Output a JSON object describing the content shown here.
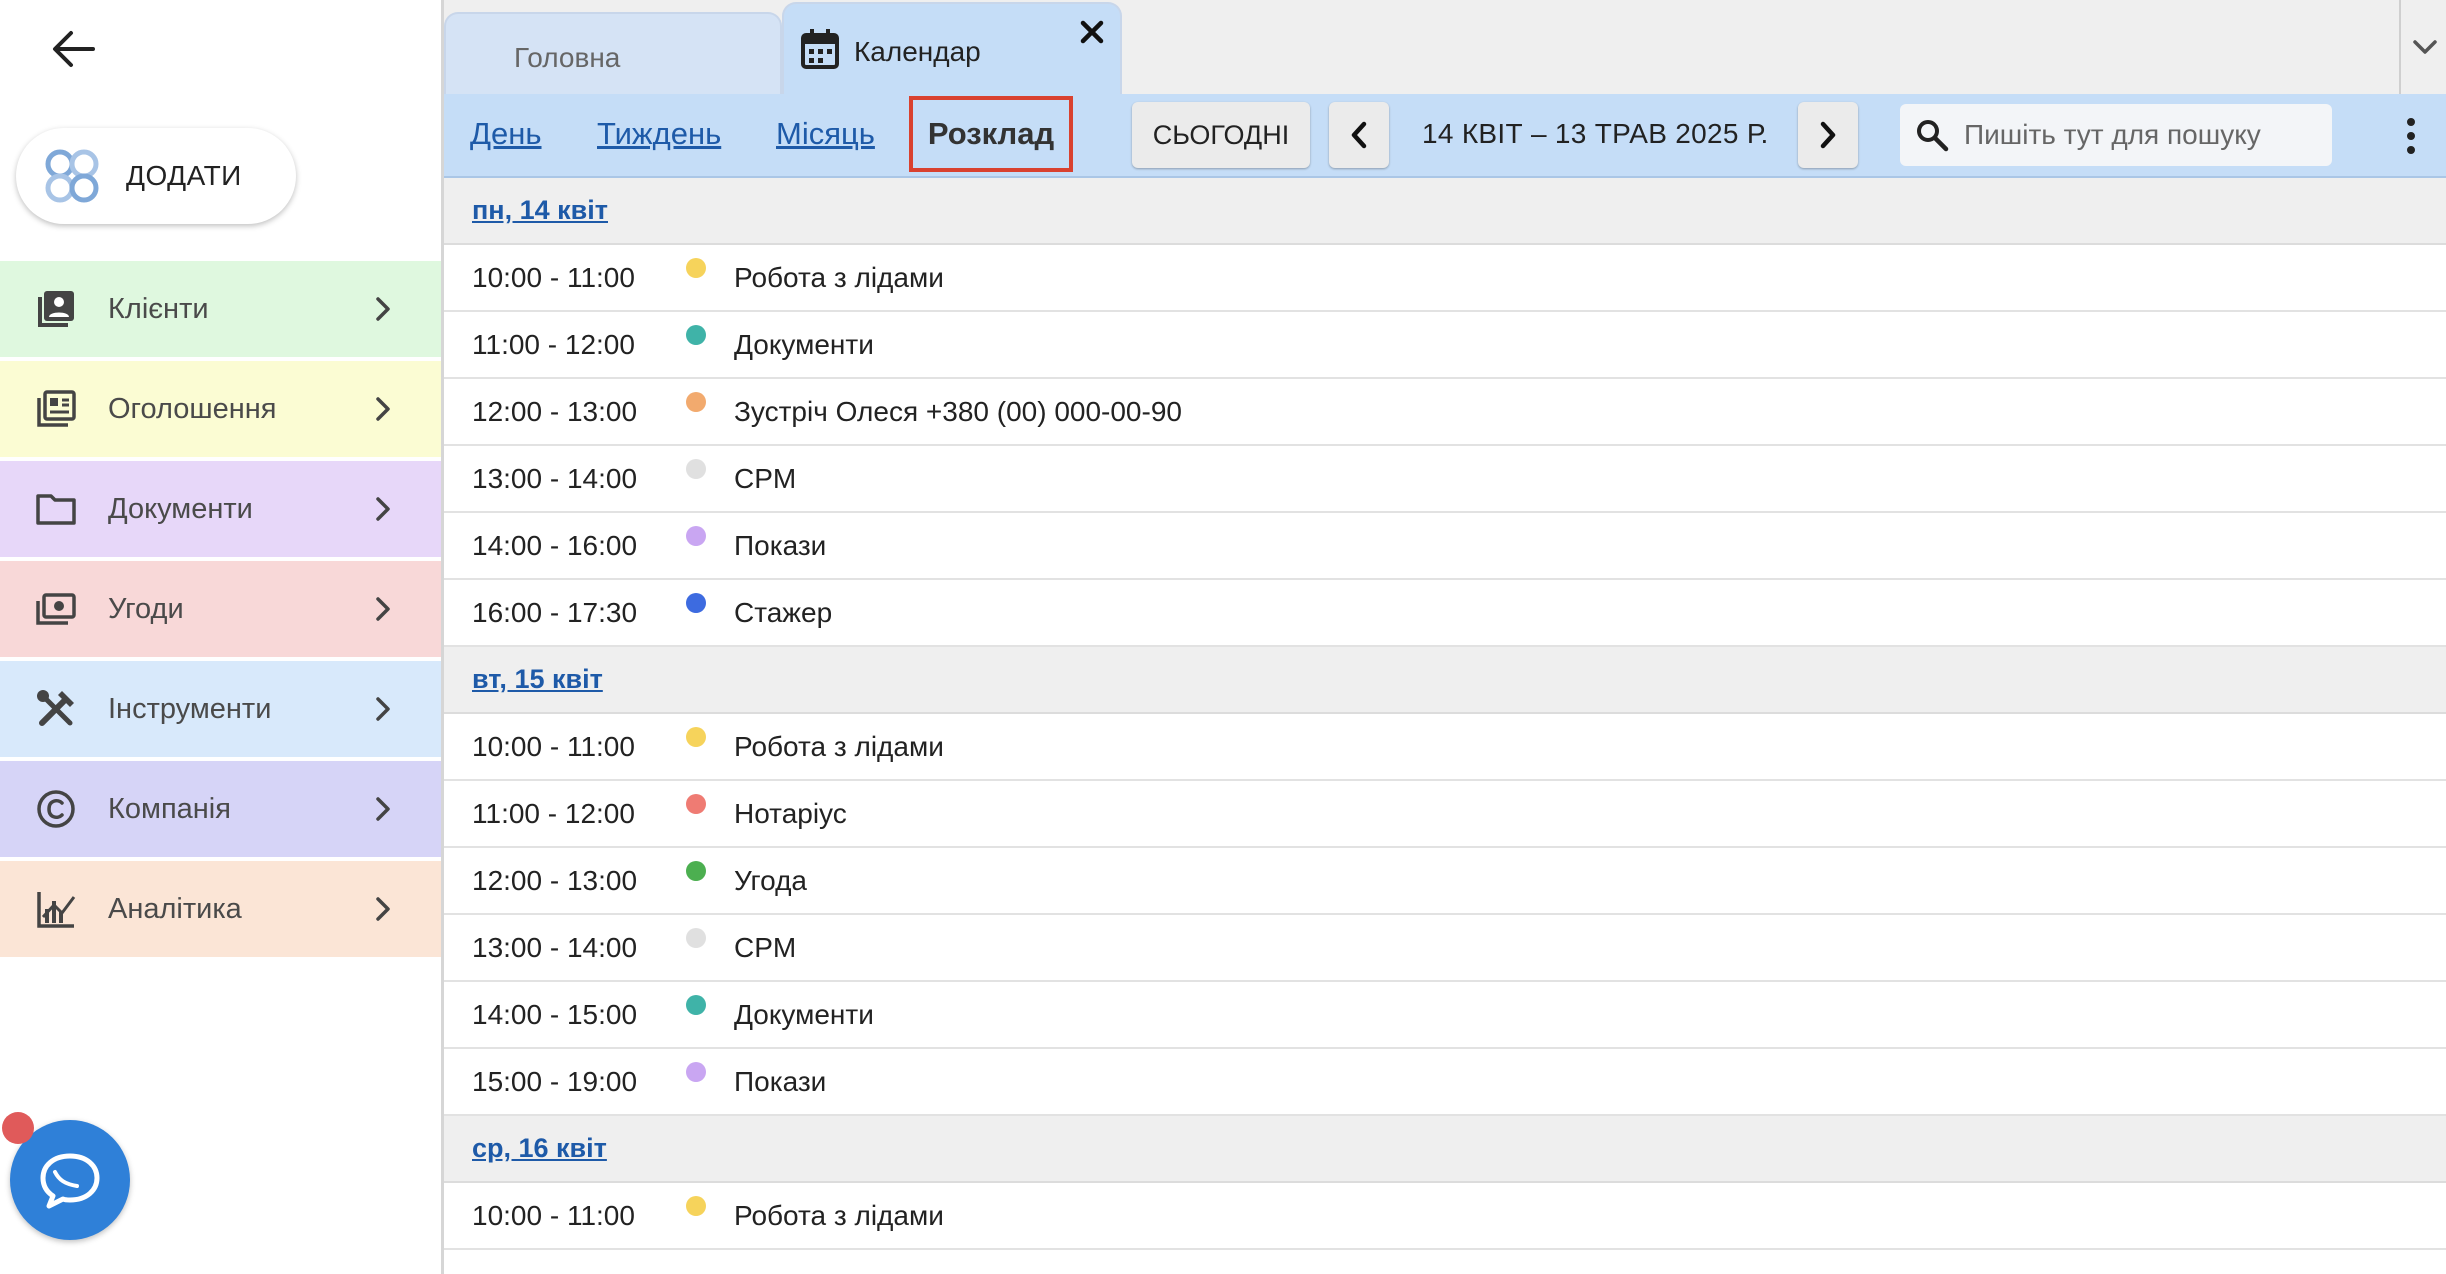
{
  "sidebar": {
    "add_label": "ДОДАТИ",
    "items": [
      {
        "label": "Клієнти",
        "icon": "contacts-icon",
        "color": "#dff8df"
      },
      {
        "label": "Оголошення",
        "icon": "listing-icon",
        "color": "#fbfcd3"
      },
      {
        "label": "Документи",
        "icon": "folder-icon",
        "color": "#e7d7f9"
      },
      {
        "label": "Угоди",
        "icon": "money-icon",
        "color": "#f8d8d8"
      },
      {
        "label": "Інструменти",
        "icon": "tools-icon",
        "color": "#d8e9fb"
      },
      {
        "label": "Компанія",
        "icon": "copyright-icon",
        "color": "#d6d4f7"
      },
      {
        "label": "Аналітика",
        "icon": "analytics-icon",
        "color": "#fbe5d6"
      }
    ]
  },
  "tabs": [
    {
      "label": "Головна"
    },
    {
      "label": "Календар"
    }
  ],
  "toolbar": {
    "views": [
      "День",
      "Тиждень",
      "Місяць",
      "Розклад"
    ],
    "today_label": "СЬОГОДНІ",
    "date_range": "14 КВІТ – 13 ТРАВ 2025 Р.",
    "search_placeholder": "Пишіть тут для пошуку"
  },
  "days": [
    {
      "header": "пн, 14 квіт",
      "events": [
        {
          "time": "10:00 - 11:00",
          "title": "Робота з лідами",
          "color": "#f6d35b"
        },
        {
          "time": "11:00 - 12:00",
          "title": "Документи",
          "color": "#3fb3a8"
        },
        {
          "time": "12:00 - 13:00",
          "title": "Зустріч Олеся +380 (00) 000-00-90",
          "color": "#f2aa6e"
        },
        {
          "time": "13:00 - 14:00",
          "title": "CPM",
          "color": "#e0e0e0"
        },
        {
          "time": "14:00 - 16:00",
          "title": "Покази",
          "color": "#c9a6f2"
        },
        {
          "time": "16:00 - 17:30",
          "title": "Стажер",
          "color": "#3d6be0"
        }
      ]
    },
    {
      "header": "вт, 15 квіт",
      "events": [
        {
          "time": "10:00 - 11:00",
          "title": "Робота з лідами",
          "color": "#f6d35b"
        },
        {
          "time": "11:00 - 12:00",
          "title": "Нотаріус",
          "color": "#ef7b73"
        },
        {
          "time": "12:00 - 13:00",
          "title": "Угода",
          "color": "#4caf50"
        },
        {
          "time": "13:00 - 14:00",
          "title": "CPM",
          "color": "#e0e0e0"
        },
        {
          "time": "14:00 - 15:00",
          "title": "Документи",
          "color": "#3fb3a8"
        },
        {
          "time": "15:00 - 19:00",
          "title": "Покази",
          "color": "#c9a6f2"
        }
      ]
    },
    {
      "header": "ср, 16 квіт",
      "events": [
        {
          "time": "10:00 - 11:00",
          "title": "Робота з лідами",
          "color": "#f6d35b"
        }
      ]
    }
  ]
}
